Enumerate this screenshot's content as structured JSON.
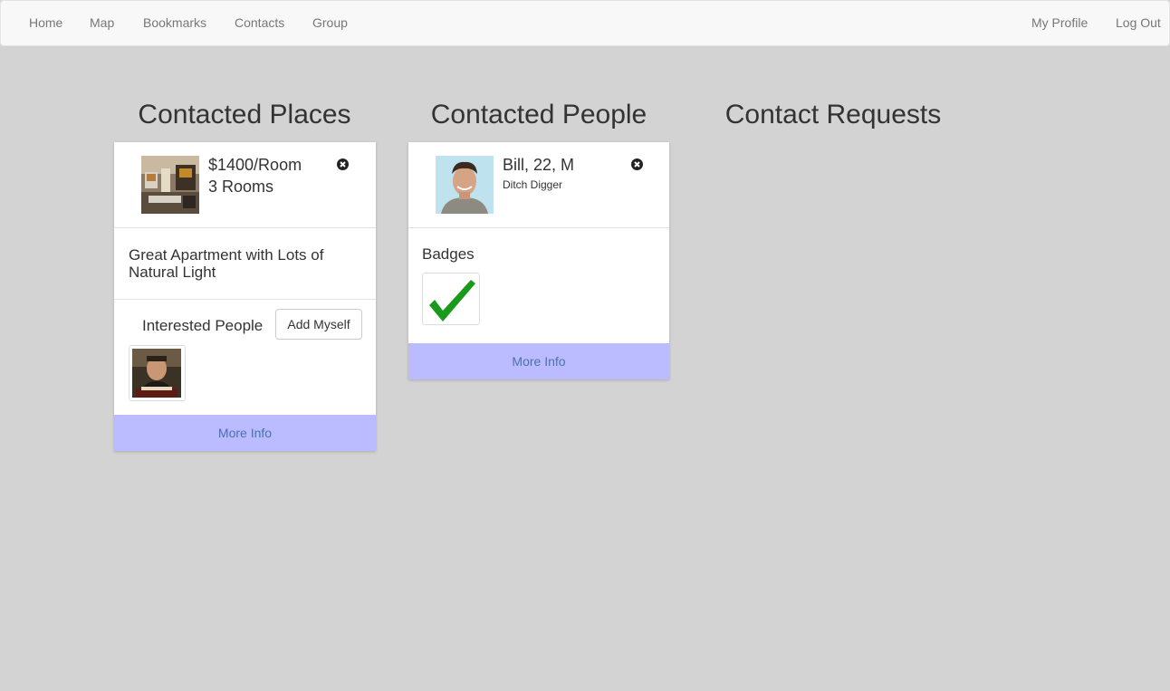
{
  "nav": {
    "left": [
      "Home",
      "Map",
      "Bookmarks",
      "Contacts",
      "Group"
    ],
    "right": [
      "My Profile",
      "Log Out"
    ]
  },
  "columns": {
    "places_title": "Contacted Places",
    "people_title": "Contacted People",
    "requests_title": "Contact Requests"
  },
  "place_card": {
    "price": "$1400/Room",
    "rooms": "3 Rooms",
    "description": "Great Apartment with Lots of Natural Light",
    "interested_label": "Interested People",
    "add_button": "Add Myself",
    "more_info": "More Info"
  },
  "person_card": {
    "name_line": "Bill, 22, M",
    "occupation": "Ditch Digger",
    "badges_label": "Badges",
    "more_info": "More Info"
  },
  "colors": {
    "more_info_bg": "#bbbcff",
    "more_info_text": "#4c6fb5",
    "badge_check": "#1a9a1a"
  }
}
